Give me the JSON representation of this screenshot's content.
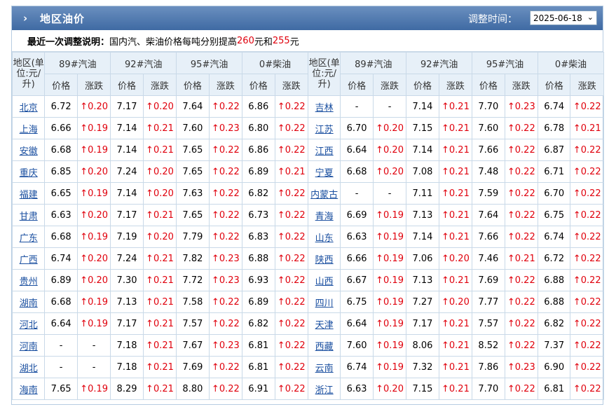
{
  "header": {
    "title": "地区油价",
    "adjust_label": "调整时间：",
    "adjust_date": "2025-06-18"
  },
  "note": {
    "label": "最近一次调整说明：",
    "text_before": "国内汽、柴油价格每吨分别提高",
    "gas_increase": "260",
    "mid": "元和",
    "diesel_increase": "255",
    "after": "元"
  },
  "table": {
    "region_header": "地区(单位:元/升)",
    "fuel_headers": [
      "89#汽油",
      "92#汽油",
      "95#汽油",
      "0#柴油"
    ],
    "sub_headers": [
      "价格",
      "涨跌"
    ],
    "rows": [
      {
        "left": {
          "region": "北京",
          "vals": [
            "6.72",
            "↑0.20",
            "7.17",
            "↑0.20",
            "7.64",
            "↑0.22",
            "6.86",
            "↑0.22"
          ]
        },
        "right": {
          "region": "吉林",
          "vals": [
            "-",
            "-",
            "7.14",
            "↑0.21",
            "7.70",
            "↑0.23",
            "6.74",
            "↑0.22"
          ]
        }
      },
      {
        "left": {
          "region": "上海",
          "vals": [
            "6.66",
            "↑0.19",
            "7.14",
            "↑0.21",
            "7.60",
            "↑0.23",
            "6.80",
            "↑0.22"
          ]
        },
        "right": {
          "region": "江苏",
          "vals": [
            "6.70",
            "↑0.20",
            "7.15",
            "↑0.21",
            "7.60",
            "↑0.22",
            "6.78",
            "↑0.21"
          ]
        }
      },
      {
        "left": {
          "region": "安徽",
          "vals": [
            "6.68",
            "↑0.19",
            "7.14",
            "↑0.21",
            "7.65",
            "↑0.22",
            "6.86",
            "↑0.22"
          ]
        },
        "right": {
          "region": "江西",
          "vals": [
            "6.64",
            "↑0.20",
            "7.14",
            "↑0.21",
            "7.66",
            "↑0.22",
            "6.87",
            "↑0.22"
          ]
        }
      },
      {
        "left": {
          "region": "重庆",
          "vals": [
            "6.85",
            "↑0.20",
            "7.24",
            "↑0.20",
            "7.65",
            "↑0.22",
            "6.89",
            "↑0.21"
          ]
        },
        "right": {
          "region": "宁夏",
          "vals": [
            "6.68",
            "↑0.20",
            "7.08",
            "↑0.21",
            "7.48",
            "↑0.22",
            "6.71",
            "↑0.22"
          ]
        }
      },
      {
        "left": {
          "region": "福建",
          "vals": [
            "6.65",
            "↑0.19",
            "7.14",
            "↑0.20",
            "7.63",
            "↑0.22",
            "6.82",
            "↑0.22"
          ]
        },
        "right": {
          "region": "内蒙古",
          "vals": [
            "-",
            "-",
            "7.11",
            "↑0.21",
            "7.59",
            "↑0.22",
            "6.70",
            "↑0.22"
          ]
        }
      },
      {
        "left": {
          "region": "甘肃",
          "vals": [
            "6.63",
            "↑0.20",
            "7.17",
            "↑0.21",
            "7.65",
            "↑0.22",
            "6.73",
            "↑0.22"
          ]
        },
        "right": {
          "region": "青海",
          "vals": [
            "6.69",
            "↑0.19",
            "7.13",
            "↑0.21",
            "7.64",
            "↑0.22",
            "6.75",
            "↑0.22"
          ]
        }
      },
      {
        "left": {
          "region": "广东",
          "vals": [
            "6.68",
            "↑0.19",
            "7.19",
            "↑0.20",
            "7.79",
            "↑0.22",
            "6.83",
            "↑0.22"
          ]
        },
        "right": {
          "region": "山东",
          "vals": [
            "6.63",
            "↑0.19",
            "7.14",
            "↑0.21",
            "7.66",
            "↑0.22",
            "6.74",
            "↑0.22"
          ]
        }
      },
      {
        "left": {
          "region": "广西",
          "vals": [
            "6.74",
            "↑0.20",
            "7.24",
            "↑0.21",
            "7.82",
            "↑0.23",
            "6.88",
            "↑0.22"
          ]
        },
        "right": {
          "region": "陕西",
          "vals": [
            "6.66",
            "↑0.19",
            "7.06",
            "↑0.20",
            "7.46",
            "↑0.21",
            "6.72",
            "↑0.22"
          ]
        }
      },
      {
        "left": {
          "region": "贵州",
          "vals": [
            "6.89",
            "↑0.20",
            "7.30",
            "↑0.21",
            "7.72",
            "↑0.23",
            "6.93",
            "↑0.22"
          ]
        },
        "right": {
          "region": "山西",
          "vals": [
            "6.67",
            "↑0.19",
            "7.13",
            "↑0.21",
            "7.69",
            "↑0.22",
            "6.88",
            "↑0.22"
          ]
        }
      },
      {
        "left": {
          "region": "湖南",
          "vals": [
            "6.68",
            "↑0.19",
            "7.13",
            "↑0.21",
            "7.58",
            "↑0.22",
            "6.89",
            "↑0.22"
          ]
        },
        "right": {
          "region": "四川",
          "vals": [
            "6.75",
            "↑0.19",
            "7.27",
            "↑0.20",
            "7.77",
            "↑0.22",
            "6.88",
            "↑0.22"
          ]
        }
      },
      {
        "left": {
          "region": "河北",
          "vals": [
            "6.64",
            "↑0.19",
            "7.17",
            "↑0.21",
            "7.57",
            "↑0.22",
            "6.82",
            "↑0.22"
          ]
        },
        "right": {
          "region": "天津",
          "vals": [
            "6.64",
            "↑0.19",
            "7.17",
            "↑0.21",
            "7.57",
            "↑0.22",
            "6.82",
            "↑0.22"
          ]
        }
      },
      {
        "left": {
          "region": "河南",
          "vals": [
            "-",
            "-",
            "7.18",
            "↑0.21",
            "7.67",
            "↑0.23",
            "6.81",
            "↑0.22"
          ]
        },
        "right": {
          "region": "西藏",
          "vals": [
            "7.60",
            "↑0.19",
            "8.06",
            "↑0.21",
            "8.52",
            "↑0.22",
            "7.37",
            "↑0.22"
          ]
        }
      },
      {
        "left": {
          "region": "湖北",
          "vals": [
            "-",
            "-",
            "7.18",
            "↑0.21",
            "7.69",
            "↑0.22",
            "6.81",
            "↑0.22"
          ]
        },
        "right": {
          "region": "云南",
          "vals": [
            "6.74",
            "↑0.19",
            "7.32",
            "↑0.21",
            "7.86",
            "↑0.23",
            "6.90",
            "↑0.22"
          ]
        }
      },
      {
        "left": {
          "region": "海南",
          "vals": [
            "7.65",
            "↑0.19",
            "8.29",
            "↑0.21",
            "8.80",
            "↑0.22",
            "6.91",
            "↑0.22"
          ]
        },
        "right": {
          "region": "浙江",
          "vals": [
            "6.63",
            "↑0.20",
            "7.15",
            "↑0.21",
            "7.70",
            "↑0.22",
            "6.81",
            "↑0.22"
          ]
        }
      }
    ]
  }
}
